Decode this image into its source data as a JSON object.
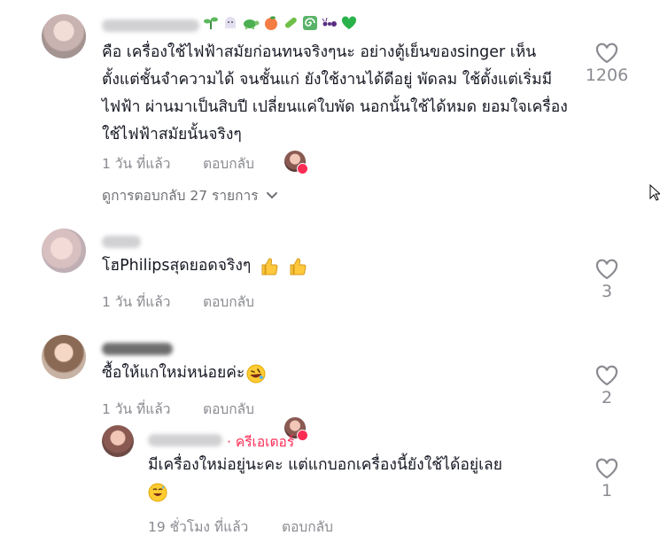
{
  "comments": [
    {
      "text": "คือ เครื่องใช้ไฟฟ้าสมัยก่อนทนจริงๆนะ อย่างตู้เย็นของsinger เห็นตั้งแต่ชั้นจำความได้ จนชั้นแก่ ยังใช้งานได้ดีอยู่ พัดลม ใช้ตั้งแต่เริ่มมีไฟฟ้า ผ่านมาเป็นสิบปี เปลี่ยนแค่ใบพัด นอกนั้นใช้ได้หมด ยอมใจเครื่องใช้ไฟฟ้าสมัยนั้นจริงๆ",
      "time": "1 วัน ที่แล้ว",
      "reply_label": "ตอบกลับ",
      "likes": "1206",
      "view_replies": "ดูการตอบกลับ 27 รายการ",
      "name_emojis": [
        "plant",
        "ghost",
        "turtle",
        "peach",
        "cucumber",
        "spiral",
        "ant",
        "green-heart"
      ]
    },
    {
      "text": "โฮPhilipsสุดยอดจริงๆ",
      "time": "1 วัน ที่แล้ว",
      "reply_label": "ตอบกลับ",
      "likes": "3"
    },
    {
      "text": "ซื้อให้แกใหม่หน่อยค่ะ",
      "time": "1 วัน ที่แล้ว",
      "reply_label": "ตอบกลับ",
      "likes": "2"
    },
    {
      "creator_label": "· ครีเอเตอร์",
      "text": "มีเครื่องใหม่อยู่นะคะ แต่แกบอกเครื่องนี้ยังใช้ได้อยู่เลย",
      "time": "19 ชั่วโมง ที่แล้ว",
      "reply_label": "ตอบกลับ",
      "likes": "1"
    }
  ],
  "colors": {
    "accent": "#fe2c55",
    "muted": "#8a8b91",
    "text": "#161823"
  }
}
